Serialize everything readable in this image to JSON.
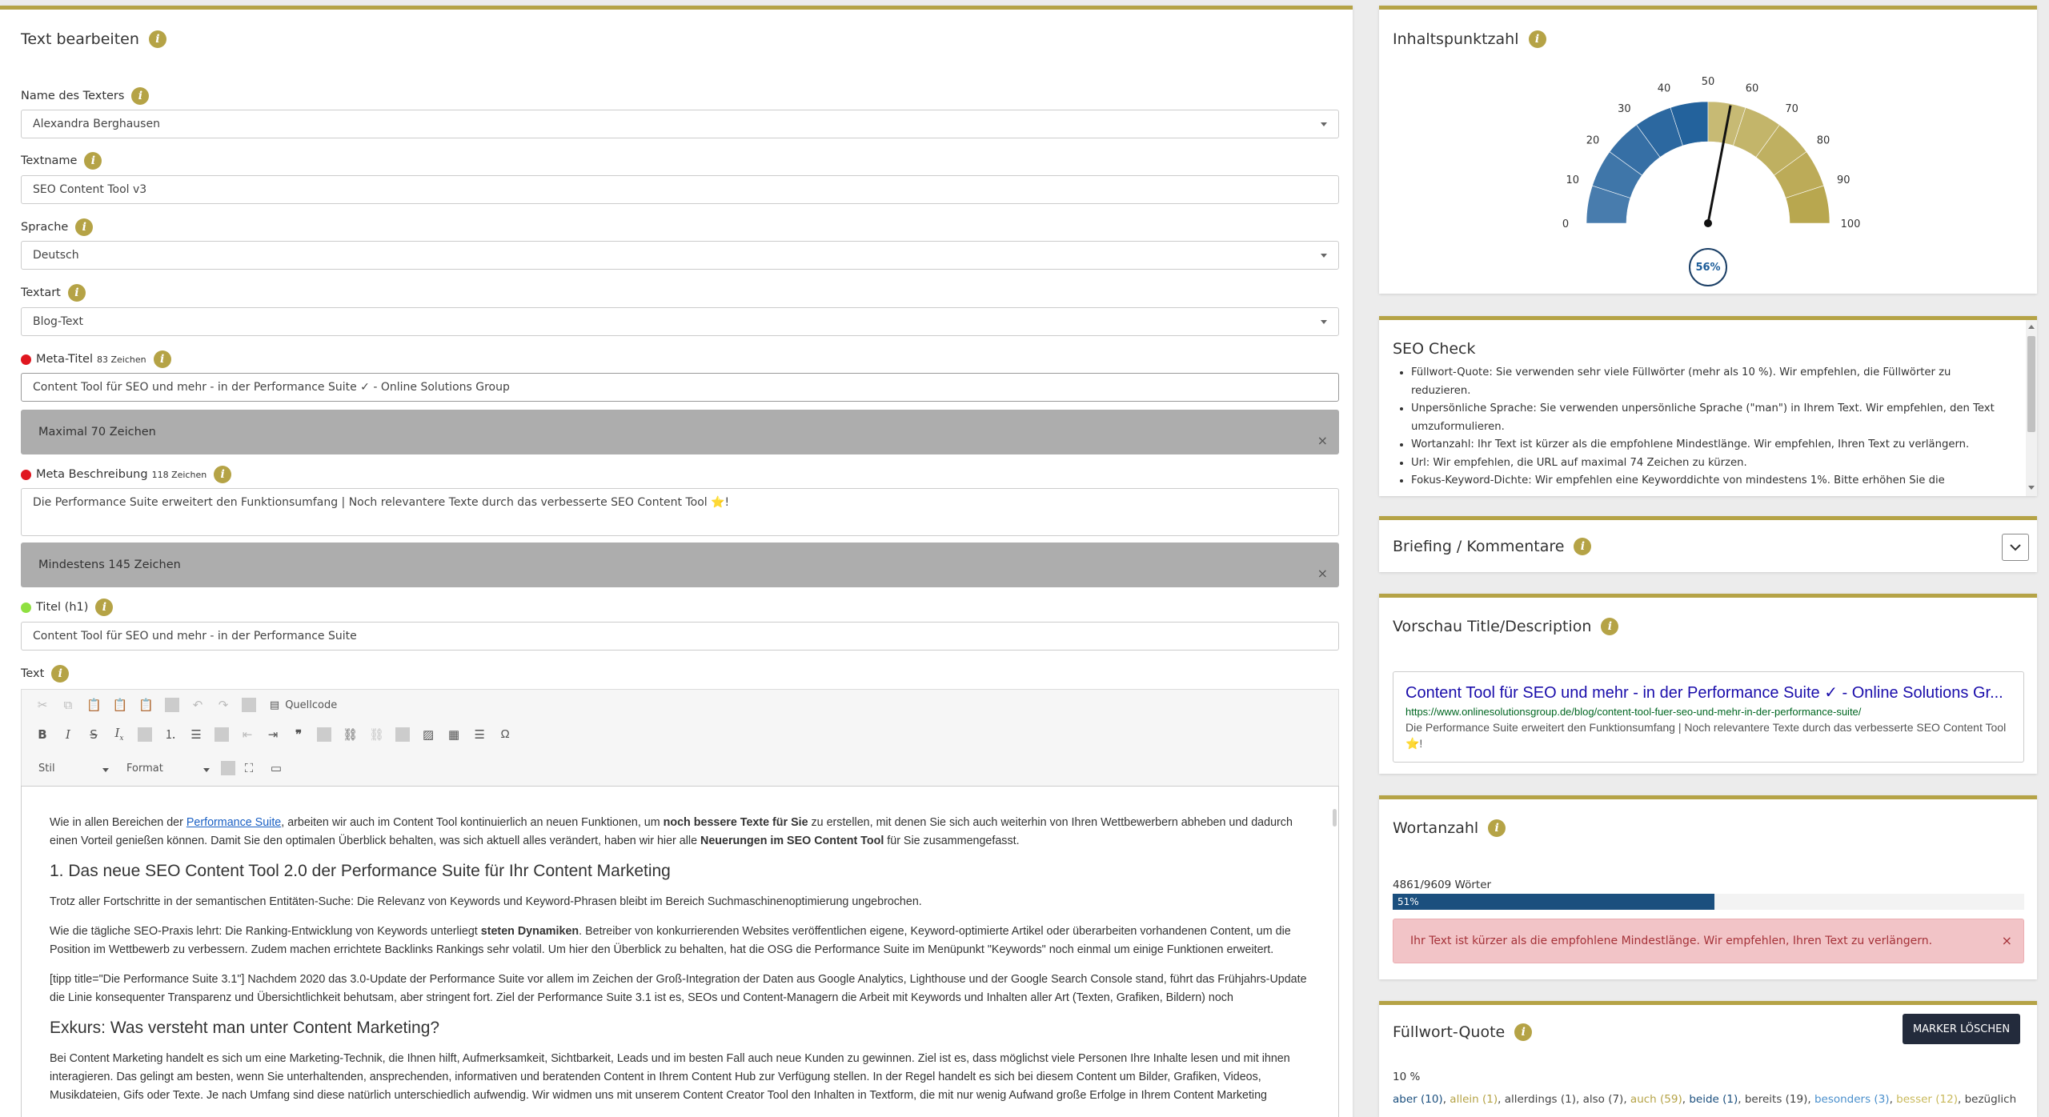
{
  "editor": {
    "title": "Text bearbeiten",
    "writer_label": "Name des Texters",
    "writer_value": "Alexandra Berghausen",
    "textname_label": "Textname",
    "textname_value": "SEO Content Tool v3",
    "language_label": "Sprache",
    "language_value": "Deutsch",
    "texttype_label": "Textart",
    "texttype_value": "Blog-Text",
    "meta_title_label": "Meta-Titel",
    "meta_title_count": "83 Zeichen",
    "meta_title_value": "Content Tool für SEO und mehr - in der Performance Suite ✓ - Online Solutions Group",
    "meta_title_hint": "Maximal 70 Zeichen",
    "meta_desc_label": "Meta Beschreibung",
    "meta_desc_count": "118 Zeichen",
    "meta_desc_value": "Die Performance Suite erweitert den Funktionsumfang | Noch relevantere Texte durch das verbesserte SEO Content Tool ⭐!",
    "meta_desc_hint": "Mindestens 145 Zeichen",
    "h1_label": "Titel (h1)",
    "h1_value": "Content Tool für SEO und mehr - in der Performance Suite",
    "text_label": "Text",
    "close_glyph": "×",
    "colors": {
      "error": "#e0161f",
      "ok": "#8fe040",
      "accent": "#b5a346"
    }
  },
  "toolbar": {
    "source_label": "Quellcode",
    "style_label": "Stil",
    "format_label": "Format"
  },
  "content": {
    "p1_a": "Wie in allen Bereichen der ",
    "p1_link": "Performance Suite",
    "p1_b": ", arbeiten wir auch im Content Tool kontinuierlich an neuen Funktionen, um ",
    "p1_bold1": "noch bessere Texte für Sie",
    "p1_c": " zu erstellen, mit denen Sie sich auch weiterhin von Ihren Wettbewerbern abheben und dadurch einen Vorteil genießen können. Damit Sie den optimalen Überblick behalten, was sich aktuell alles verändert, haben wir hier alle ",
    "p1_bold2": "Neuerungen im SEO Content Tool",
    "p1_d": " für Sie zusammengefasst.",
    "h2_1": "1. Das neue SEO Content Tool 2.0 der Performance Suite für Ihr Content Marketing",
    "p2": "Trotz aller Fortschritte in der semantischen Entitäten-Suche: Die Relevanz von Keywords und Keyword-Phrasen bleibt im Bereich Suchmaschinenoptimierung ungebrochen.",
    "p3_a": "Wie die tägliche SEO-Praxis lehrt: Die Ranking-Entwicklung von Keywords unterliegt ",
    "p3_bold": "steten Dynamiken",
    "p3_b": ". Betreiber von konkurrierenden Websites veröffentlichen eigene, Keyword-optimierte Artikel oder überarbeiten vorhandenen Content, um die Position im Wettbewerb zu verbessern. Zudem machen errichtete Backlinks Rankings sehr volatil. Um hier den Überblick zu behalten, hat die OSG die Performance Suite im Menüpunkt \"Keywords\" noch einmal um einige Funktionen erweitert.",
    "p4": "[tipp title=\"Die Performance Suite 3.1\"] Nachdem 2020 das 3.0-Update der Performance Suite vor allem im Zeichen der Groß-Integration der Daten aus Google Analytics, Lighthouse und der Google Search Console stand, führt das Frühjahrs-Update die Linie konsequenter Transparenz und Übersichtlichkeit behutsam, aber stringent fort. Ziel der Performance Suite 3.1 ist es, SEOs und Content-Managern die Arbeit mit Keywords und Inhalten aller Art (Texten, Grafiken, Bildern) noch",
    "h2_2": "Exkurs: Was versteht man unter Content Marketing?",
    "p5": "Bei Content Marketing handelt es sich um eine Marketing-Technik, die Ihnen hilft, Aufmerksamkeit, Sichtbarkeit, Leads und im besten Fall auch neue Kunden zu gewinnen. Ziel ist es, dass möglichst viele Personen Ihre Inhalte lesen und mit ihnen interagieren. Das gelingt am besten, wenn Sie unterhaltenden, ansprechenden, informativen und beratenden Content in Ihrem Content Hub zur Verfügung stellen. In der Regel handelt es sich bei diesem Content um Bilder, Grafiken, Videos, Musikdateien, Gifs oder Texte. Je nach Umfang sind diese natürlich unterschiedlich aufwendig. Wir widmen uns mit unserem Content Creator Tool den Inhalten in Textform, die mit nur wenig Aufwand große Erfolge in Ihrem Content Marketing"
  },
  "score": {
    "title": "Inhaltspunktzahl",
    "value_label": "56%",
    "value": 56,
    "ticks": [
      "0",
      "10",
      "20",
      "30",
      "40",
      "50",
      "60",
      "70",
      "80",
      "90",
      "100"
    ],
    "colors": {
      "blue": "#1b5c99",
      "gold": "#b5a346"
    }
  },
  "seo": {
    "title": "SEO Check",
    "items": [
      "Füllwort-Quote:  Sie verwenden sehr viele Füllwörter (mehr als 10 %). Wir empfehlen, die Füllwörter zu reduzieren.",
      "Unpersönliche Sprache:  Sie verwenden unpersönliche Sprache (\"man\") in Ihrem Text. Wir empfehlen, den Text umzuformulieren.",
      "Wortanzahl:  Ihr Text ist kürzer als die empfohlene Mindestlänge. Wir empfehlen, Ihren Text zu verlängern.",
      "Url:  Wir empfehlen, die URL auf maximal 74 Zeichen zu kürzen.",
      "Fokus-Keyword-Dichte: Wir empfehlen eine Keyworddichte von mindestens 1%. Bitte erhöhen Sie die"
    ]
  },
  "briefing": {
    "title": "Briefing / Kommentare"
  },
  "preview": {
    "title": "Vorschau Title/Description",
    "serp_title": "Content Tool für SEO und mehr - in der Performance Suite ✓ - Online Solutions Gr...",
    "serp_url": "https://www.onlinesolutionsgroup.de/blog/content-tool-fuer-seo-und-mehr-in-der-performance-suite/",
    "serp_desc": "Die Performance Suite erweitert den Funktionsumfang | Noch relevantere Texte durch das verbesserte SEO Content Tool ⭐!"
  },
  "wordcount": {
    "title": "Wortanzahl",
    "count_label": "4861/9609 Wörter",
    "bar_label": "51%",
    "percent": 51,
    "warning": "Ihr Text ist kürzer als die empfohlene Mindestlänge. Wir empfehlen, Ihren Text zu verlängern.",
    "colors": {
      "bar": "#1b4f7e",
      "warning_bg": "#f2c4c7",
      "warning_text": "#a53239"
    }
  },
  "filler": {
    "title": "Füllwort-Quote",
    "clear_button": "MARKER LÖSCHEN",
    "percent_label": "10 %",
    "words": [
      {
        "w": "aber (10)",
        "c": "#1b4f7e"
      },
      {
        "w": "allein (1)",
        "c": "#b5a346"
      },
      {
        "w": "allerdings (1)",
        "c": "#444444"
      },
      {
        "w": "also (7)",
        "c": "#444444"
      },
      {
        "w": "auch (59)",
        "c": "#b5a346"
      },
      {
        "w": "beide (1)",
        "c": "#1b4f7e"
      },
      {
        "w": "bereits (19)",
        "c": "#444444"
      },
      {
        "w": "besonders (3)",
        "c": "#4a8fcc"
      },
      {
        "w": "besser (12)",
        "c": "#c9b95a"
      },
      {
        "w": "bezüglich",
        "c": "#444444"
      }
    ]
  }
}
